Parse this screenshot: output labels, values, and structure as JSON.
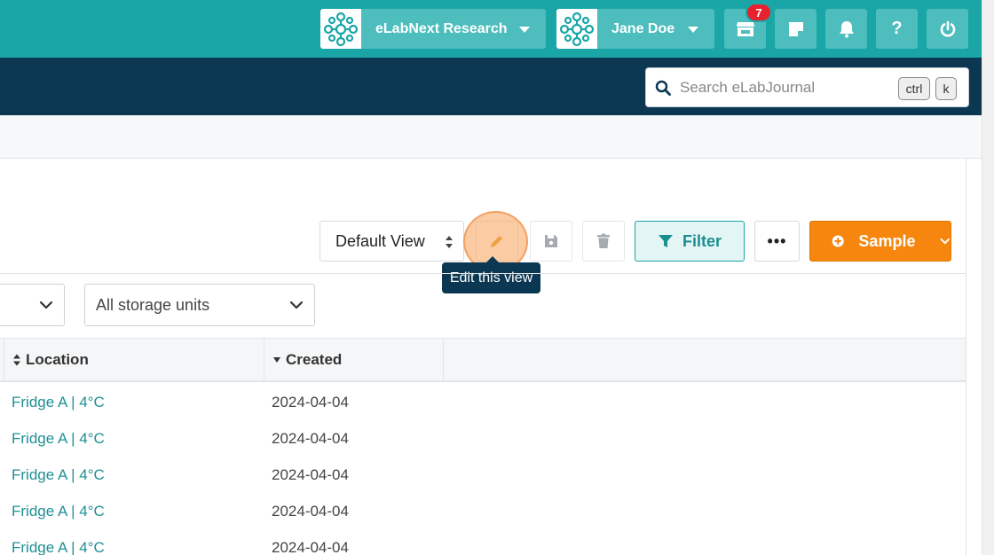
{
  "topbar": {
    "org_label": "eLabNext Research",
    "user_label": "Jane Doe",
    "store_badge": "7",
    "icons": [
      "store-icon",
      "note-icon",
      "bell-icon",
      "help-icon",
      "power-icon"
    ]
  },
  "search": {
    "placeholder": "Search eLabJournal",
    "kbd_ctrl": "ctrl",
    "kbd_k": "k"
  },
  "toolbar": {
    "view_select": "Default View",
    "filter_label": "Filter",
    "more_label": "•••",
    "sample_label": "Sample",
    "tooltip": "Edit this view"
  },
  "filters": {
    "storage_units": "All storage units"
  },
  "table": {
    "columns": [
      "Location",
      "Created"
    ],
    "rows": [
      {
        "location": "Fridge A | 4°C",
        "created": "2024-04-04"
      },
      {
        "location": "Fridge A | 4°C",
        "created": "2024-04-04"
      },
      {
        "location": "Fridge A | 4°C",
        "created": "2024-04-04"
      },
      {
        "location": "Fridge A | 4°C",
        "created": "2024-04-04"
      },
      {
        "location": "Fridge A | 4°C",
        "created": "2024-04-04"
      }
    ]
  },
  "colors": {
    "teal": "#1aa6a6",
    "navy": "#0b3752",
    "orange": "#f7860f"
  }
}
